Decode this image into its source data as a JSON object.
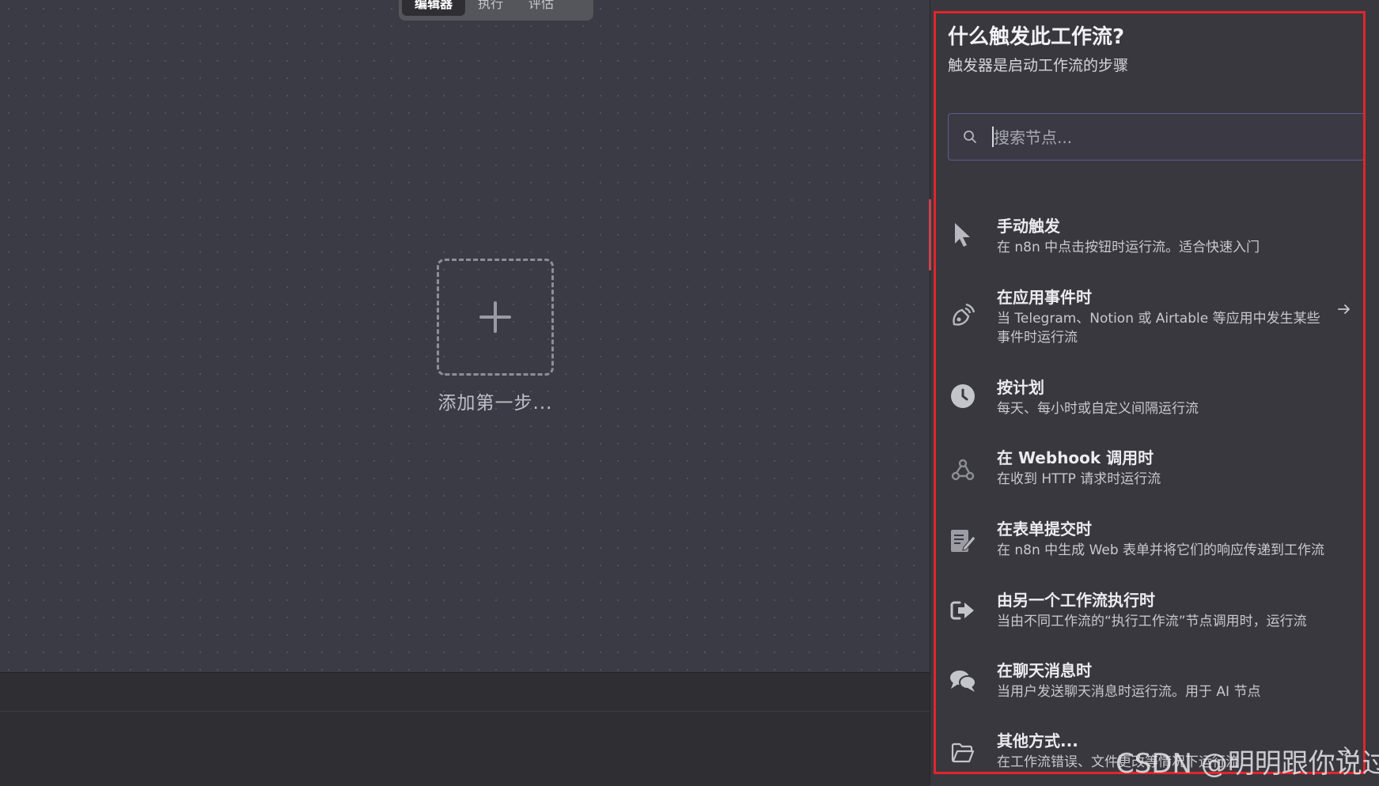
{
  "tabs": [
    {
      "label": "编辑器"
    },
    {
      "label": "执行"
    },
    {
      "label": "评估"
    }
  ],
  "canvas": {
    "add_first_step_label": "添加第一步..."
  },
  "panel": {
    "title": "什么触发此工作流?",
    "subtitle": "触发器是启动工作流的步骤",
    "search_placeholder": "搜索节点...",
    "items": [
      {
        "icon": "cursor-icon",
        "name": "手动触发",
        "desc": "在 n8n 中点击按钮时运行流。适合快速入门"
      },
      {
        "icon": "satellite-icon",
        "name": "在应用事件时",
        "desc": "当 Telegram、Notion 或 Airtable 等应用中发生某些事件时运行流",
        "has_arrow": true
      },
      {
        "icon": "clock-icon",
        "name": "按计划",
        "desc": "每天、每小时或自定义间隔运行流"
      },
      {
        "icon": "webhook-icon",
        "name": "在 Webhook 调用时",
        "desc": "在收到 HTTP 请求时运行流"
      },
      {
        "icon": "form-icon",
        "name": "在表单提交时",
        "desc": "在 n8n 中生成 Web 表单并将它们的响应传递到工作流"
      },
      {
        "icon": "sign-in-icon",
        "name": "由另一个工作流执行时",
        "desc": "当由不同工作流的“执行工作流”节点调用时，运行流"
      },
      {
        "icon": "chat-icon",
        "name": "在聊天消息时",
        "desc": "当用户发送聊天消息时运行流。用于 AI 节点"
      },
      {
        "icon": "folder-icon",
        "name": "其他方式...",
        "desc": "在工作流错误、文件更改等情况下运行流"
      }
    ]
  },
  "watermark": "CSDN @明明跟你说过"
}
